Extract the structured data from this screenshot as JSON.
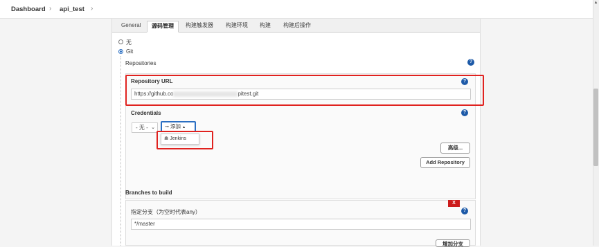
{
  "breadcrumb": {
    "items": [
      "Dashboard",
      "api_test"
    ],
    "separator": "›"
  },
  "tabs": [
    "General",
    "源码管理",
    "构建触发器",
    "构建环境",
    "构建",
    "构建后操作"
  ],
  "active_tab": "源码管理",
  "scm": {
    "options": [
      {
        "label": "无",
        "checked": false
      },
      {
        "label": "Git",
        "checked": true
      }
    ]
  },
  "repositories": {
    "heading": "Repositories",
    "url_label": "Repository URL",
    "url_value_prefix": "https://github.co",
    "url_value_suffix": "pitest.git",
    "credentials_label": "Credentials",
    "credentials_value": "- 无 -",
    "add_button": "添加",
    "add_menu_item": "Jenkins",
    "advanced_button": "高级...",
    "add_repository_button": "Add Repository"
  },
  "branches": {
    "heading": "Branches to build",
    "delete_button": "X",
    "branch_label": "指定分支（为空时代表any）",
    "branch_value": "*/master",
    "bottom_button": "增加分支"
  },
  "help_symbol": "?",
  "colors": {
    "highlight": "#e0221f",
    "accent": "#2b6fc2",
    "help": "#1d5aa8",
    "delete": "#cc1c1c"
  }
}
